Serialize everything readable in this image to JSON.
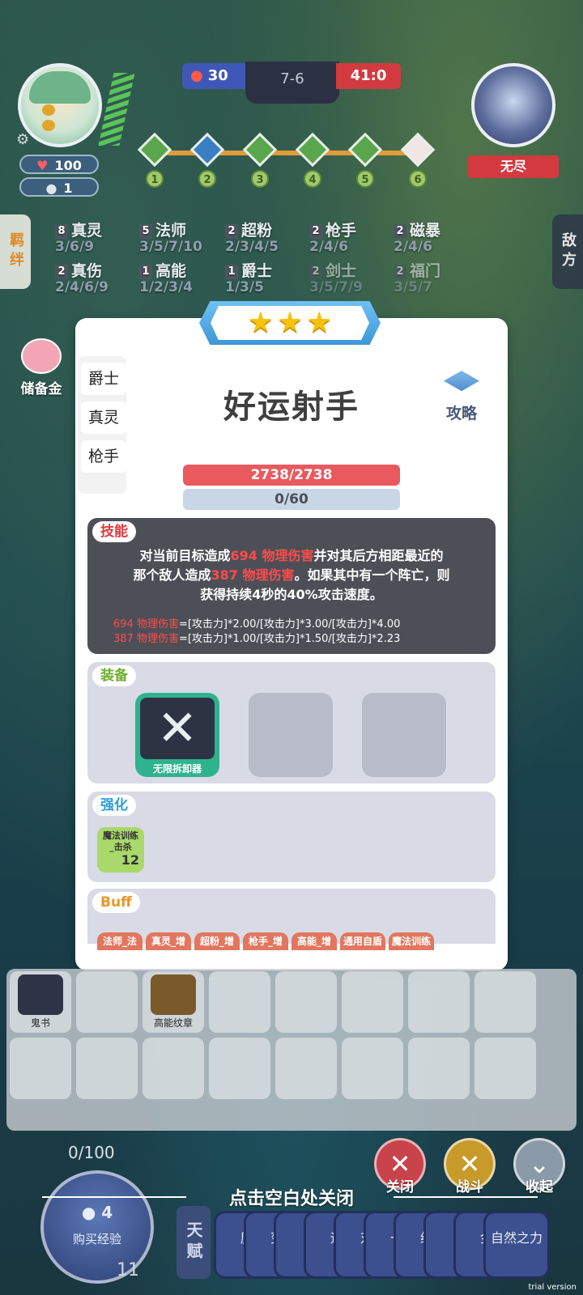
{
  "top": {
    "left_score": "30",
    "round": "7-6",
    "right_score": "41:0",
    "player_hp": "100",
    "player_coins": "1",
    "enemy_name": "无尽",
    "rounds": [
      "1",
      "2",
      "3",
      "4",
      "5",
      "6"
    ]
  },
  "side_tabs": {
    "left": "羁绊",
    "right": "敌方"
  },
  "synergies": [
    {
      "count": "8",
      "name": "真灵",
      "levels": "3/6/9"
    },
    {
      "count": "5",
      "name": "法师",
      "levels": "3/5/7/10"
    },
    {
      "count": "2",
      "name": "超粉",
      "levels": "2/3/4/5"
    },
    {
      "count": "2",
      "name": "枪手",
      "levels": "2/4/6"
    },
    {
      "count": "2",
      "name": "磁暴",
      "levels": "2/4/6"
    },
    {
      "count": "2",
      "name": "真伤",
      "levels": "2/4/6/9"
    },
    {
      "count": "1",
      "name": "高能",
      "levels": "1/2/3/4"
    },
    {
      "count": "1",
      "name": "爵士",
      "levels": "1/3/5"
    },
    {
      "count": "2",
      "name": "剑士",
      "levels": "3/5/7/9"
    },
    {
      "count": "2",
      "name": "福门",
      "levels": "3/5/7"
    }
  ],
  "piggy_label": "储备金",
  "unit": {
    "stars": 3,
    "traits": [
      "爵士",
      "真灵",
      "枪手"
    ],
    "name": "好运射手",
    "strategy_label": "攻略",
    "hp": "2738/2738",
    "mana": "0/60",
    "skill_tag": "技能",
    "skill_desc_1a": "对当前目标造成",
    "skill_desc_1b": "694 物理伤害",
    "skill_desc_1c": "并对其后方相距最近的",
    "skill_desc_2a": "那个敌人造成",
    "skill_desc_2b": "387 物理伤害",
    "skill_desc_2c": "。如果其中有一个阵亡，则",
    "skill_desc_3": "获得持续4秒的40%攻击速度。",
    "formula1_red": "694 物理伤害",
    "formula1_rest": "=[攻击力]*2.00/[攻击力]*3.00/[攻击力]*4.00",
    "formula2_red": "387 物理伤害",
    "formula2_rest": "=[攻击力]*1.00/[攻击力]*1.50/[攻击力]*2.23",
    "equip_tag": "装备",
    "equip_name": "无限拆卸器",
    "enh_tag": "强化",
    "enh_line1": "魔法训练",
    "enh_line2": "_击杀",
    "enh_value": "12",
    "buff_tag": "Buff",
    "buffs": [
      "法师_法",
      "真灵_增",
      "超粉_增",
      "枪手_增",
      "高能_增",
      "通用自盾",
      "魔法训练"
    ]
  },
  "bench": {
    "slot1_label": "鬼书",
    "slot3_label": "高能纹章"
  },
  "bottom": {
    "xp": "0/100",
    "buy_amount": "4",
    "buy_label": "购买经验",
    "level": "11",
    "close_label": "关闭",
    "fight_label": "战斗",
    "collapse_label": "收起",
    "close_hint": "点击空白处关闭",
    "talent_tab": "天赋",
    "talents": [
      "魔",
      "变",
      "【",
      "运",
      "对",
      "一",
      "纳",
      " ",
      "金",
      "自然之力"
    ]
  },
  "colors": {
    "accent_red": "#d23a40",
    "accent_blue": "#3f58b8",
    "damage_red": "#ff4b4b"
  },
  "watermark": "trial version"
}
